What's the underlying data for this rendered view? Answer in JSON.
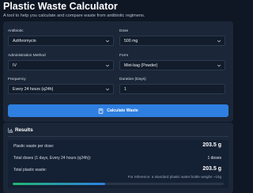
{
  "header": {
    "title": "Plastic Waste Calculator",
    "subtitle": "A tool to help you calculate and compare waste from antibiotic regimens."
  },
  "form": {
    "antibiotic": {
      "label": "Antibiotic",
      "value": "Azithromycin"
    },
    "dose": {
      "label": "Dose",
      "value": "500 mg"
    },
    "route": {
      "label": "Administration Method",
      "value": "IV"
    },
    "form_type": {
      "label": "Form",
      "value": "Mini-bag (Powder)"
    },
    "frequency": {
      "label": "Frequency",
      "value": "Every 24 hours (q24h)"
    },
    "duration": {
      "label": "Duration (Days)",
      "value": "1"
    },
    "calculate_label": "Calculate Waste"
  },
  "results": {
    "title": "Results",
    "per_dose_label": "Plastic waste per dose:",
    "per_dose_value": "203.5 g",
    "total_doses_label": "Total doses (1 days, Every 24 hours (q24h)):",
    "total_doses_value": "1 doses",
    "total_label": "Total plastic waste:",
    "total_value": "203.5 g",
    "reference_text": "For reference: a standard plastic water bottle weighs ~10g",
    "progress_fraction": 0.44
  },
  "colors": {
    "background": "#0f1724",
    "card": "#1b2738",
    "accent": "#2f7fe0",
    "progress_start": "#22b573"
  }
}
